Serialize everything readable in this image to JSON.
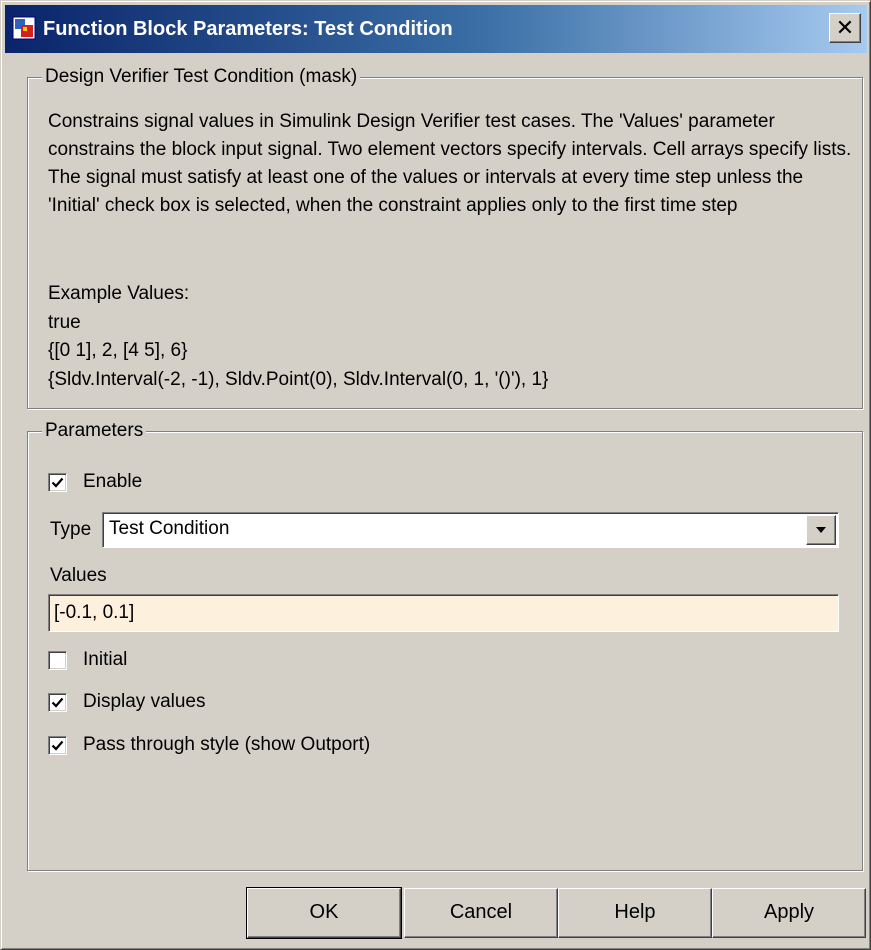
{
  "window": {
    "title": "Function Block Parameters: Test Condition",
    "close_glyph": "✕",
    "title_bar_color_start": "#0a246a",
    "title_bar_color_end": "#a6caf0",
    "background_color": "#d4d0c8"
  },
  "description_group": {
    "legend": "Design Verifier Test Condition (mask)",
    "text": "Constrains signal values in Simulink Design Verifier test cases. The 'Values' parameter constrains the block input signal.  Two element vectors specify intervals. Cell arrays specify lists.  The signal must satisfy at least one of the values or intervals at every time step unless the 'Initial' check box is selected, when the constraint applies only to the first time step",
    "examples_heading": "Example Values:",
    "examples": [
      "true",
      "{[0 1], 2, [4 5], 6}",
      "{Sldv.Interval(-2, -1), Sldv.Point(0), Sldv.Interval(0, 1, '()'), 1}"
    ]
  },
  "parameters_group": {
    "legend": "Parameters",
    "enable": {
      "label": "Enable",
      "checked": true
    },
    "type": {
      "label": "Type",
      "selected": "Test Condition"
    },
    "values": {
      "label": "Values",
      "value": "[-0.1, 0.1]",
      "background_color": "#fdf1dd"
    },
    "initial": {
      "label": "Initial",
      "checked": false
    },
    "display_values": {
      "label": "Display values",
      "checked": true
    },
    "pass_through": {
      "label": "Pass through style (show Outport)",
      "checked": true
    }
  },
  "buttons": {
    "ok": "OK",
    "cancel": "Cancel",
    "help": "Help",
    "apply": "Apply"
  },
  "icons": {
    "app": "simulink-block-icon",
    "close": "close-icon",
    "dropdown": "chevron-down-icon",
    "check": "checkmark-icon"
  }
}
